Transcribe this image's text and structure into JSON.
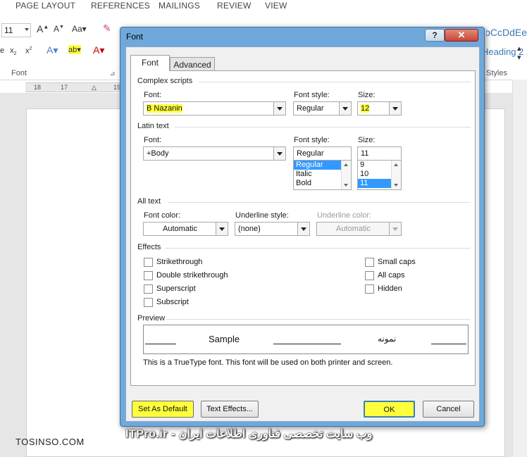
{
  "ribbon": {
    "tabs": [
      "PAGE LAYOUT",
      "REFERENCES",
      "MAILINGS",
      "REVIEW",
      "VIEW"
    ],
    "font_size": "11",
    "font_group_label": "Font",
    "styles_label": "Styles",
    "style_preview": "AaBbCcDdEe",
    "style_name": "Heading 2"
  },
  "ruler": {
    "ticks": [
      "18",
      "17",
      "15"
    ]
  },
  "dialog": {
    "title": "Font",
    "help_label": "?",
    "close_label": "✕",
    "tabs": [
      {
        "label": "Font",
        "accel": "n",
        "selected": true
      },
      {
        "label": "Advanced",
        "accel": "v",
        "selected": false
      }
    ],
    "complex": {
      "heading": "Complex scripts",
      "font_label": "Font:",
      "font_value": "B Nazanin",
      "style_label": "Font style:",
      "style_value": "Regular",
      "size_label": "Size:",
      "size_value": "12"
    },
    "latin": {
      "heading": "Latin text",
      "font_label": "Font:",
      "font_value": "+Body",
      "style_label": "Font style:",
      "style_value": "Regular",
      "style_options": [
        "Regular",
        "Italic",
        "Bold"
      ],
      "size_label": "Size:",
      "size_value": "11",
      "size_options": [
        "9",
        "10",
        "11"
      ]
    },
    "all_text": {
      "heading": "All text",
      "color_label": "Font color:",
      "color_value": "Automatic",
      "underline_label": "Underline style:",
      "underline_value": "(none)",
      "ucolor_label": "Underline color:",
      "ucolor_value": "Automatic"
    },
    "effects": {
      "heading": "Effects",
      "left": [
        "Strikethrough",
        "Double strikethrough",
        "Superscript",
        "Subscript"
      ],
      "right": [
        "Small caps",
        "All caps",
        "Hidden"
      ]
    },
    "preview": {
      "heading": "Preview",
      "sample_latin": "Sample",
      "sample_complex": "نمونه",
      "note": "This is a TrueType font. This font will be used on both printer and screen."
    },
    "buttons": {
      "default": "Set As Default",
      "effects": "Text Effects...",
      "ok": "OK",
      "cancel": "Cancel"
    }
  },
  "watermark": {
    "left": "TOSINSO.COM",
    "right": "ITPro.ir - وب سایت تخصصی فناوری اطلاعات ایران"
  }
}
